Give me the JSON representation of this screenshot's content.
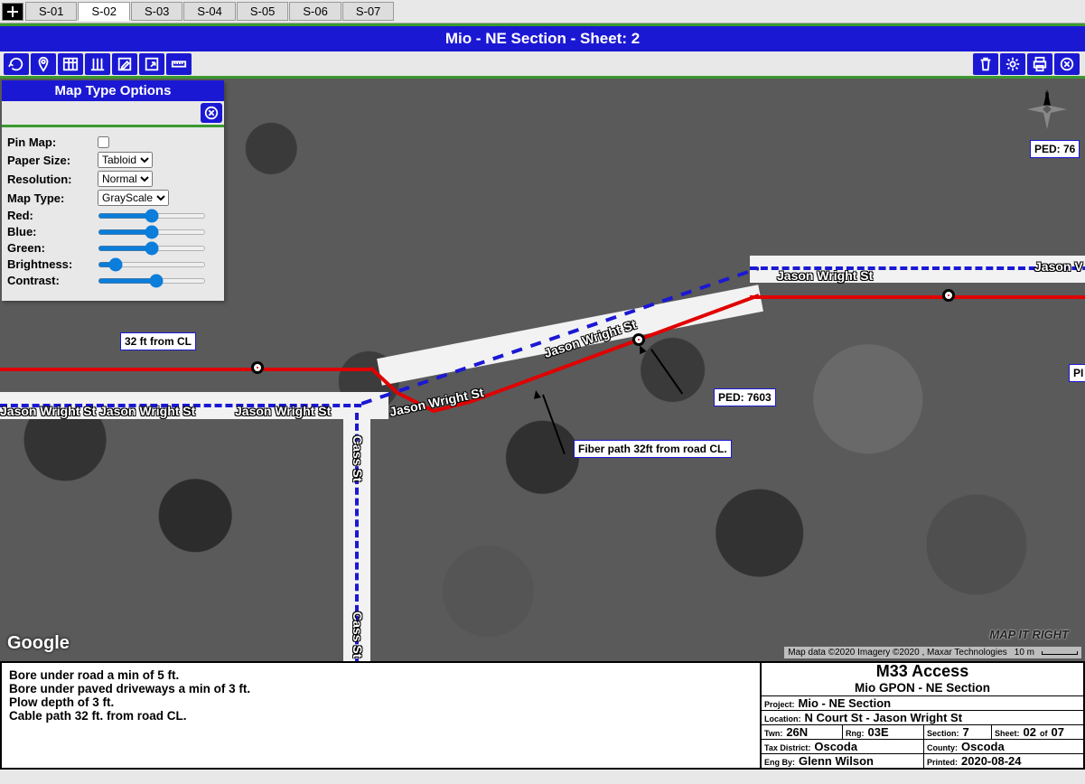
{
  "tabs": [
    "S-01",
    "S-02",
    "S-03",
    "S-04",
    "S-05",
    "S-06",
    "S-07"
  ],
  "active_tab": 1,
  "title": "Mio - NE Section - Sheet: 2",
  "panel": {
    "title": "Map Type Options",
    "pin_label": "Pin Map:",
    "paper_label": "Paper Size:",
    "paper_value": "Tabloid",
    "res_label": "Resolution:",
    "res_value": "Normal",
    "type_label": "Map Type:",
    "type_value": "GrayScale",
    "red_label": "Red:",
    "blue_label": "Blue:",
    "green_label": "Green:",
    "bright_label": "Brightness:",
    "contrast_label": "Contrast:",
    "red": 50,
    "blue": 50,
    "green": 50,
    "brightness": 12,
    "contrast": 55
  },
  "map": {
    "street1": "Jason Wright St",
    "street2": "Cass St",
    "cl_note": "32 ft from CL",
    "ped_a": "PED: 76",
    "ped_b": "PED: 7603",
    "pi_label": "PI",
    "fiber_note": "Fiber path 32ft from road CL.",
    "google": "Google",
    "attribution": "Map data ©2020 Imagery ©2020 , Maxar Technologies",
    "scale": "10 m",
    "brand": "MAP IT RIGHT"
  },
  "notes": [
    "Bore under road a min of 5 ft.",
    "Bore under paved driveways a min of 3 ft.",
    "Plow depth of 3 ft.",
    "Cable path 32 ft. from road CL."
  ],
  "titleblock": {
    "h1": "M33 Access",
    "h2": "Mio GPON - NE Section",
    "project_l": "Project:",
    "project": "Mio - NE Section",
    "loc_l": "Location:",
    "loc": "N Court St - Jason Wright St",
    "twn_l": "Twn:",
    "twn": "26N",
    "rng_l": "Rng:",
    "rng": "03E",
    "sec_l": "Section:",
    "sec": "7",
    "sheet_l": "Sheet:",
    "sheet_a": "02",
    "sheet_of": "of",
    "sheet_b": "07",
    "tax_l": "Tax District:",
    "tax": "Oscoda",
    "county_l": "County:",
    "county": "Oscoda",
    "eng_l": "Eng By:",
    "eng": "Glenn Wilson",
    "print_l": "Printed:",
    "print": "2020-08-24"
  }
}
